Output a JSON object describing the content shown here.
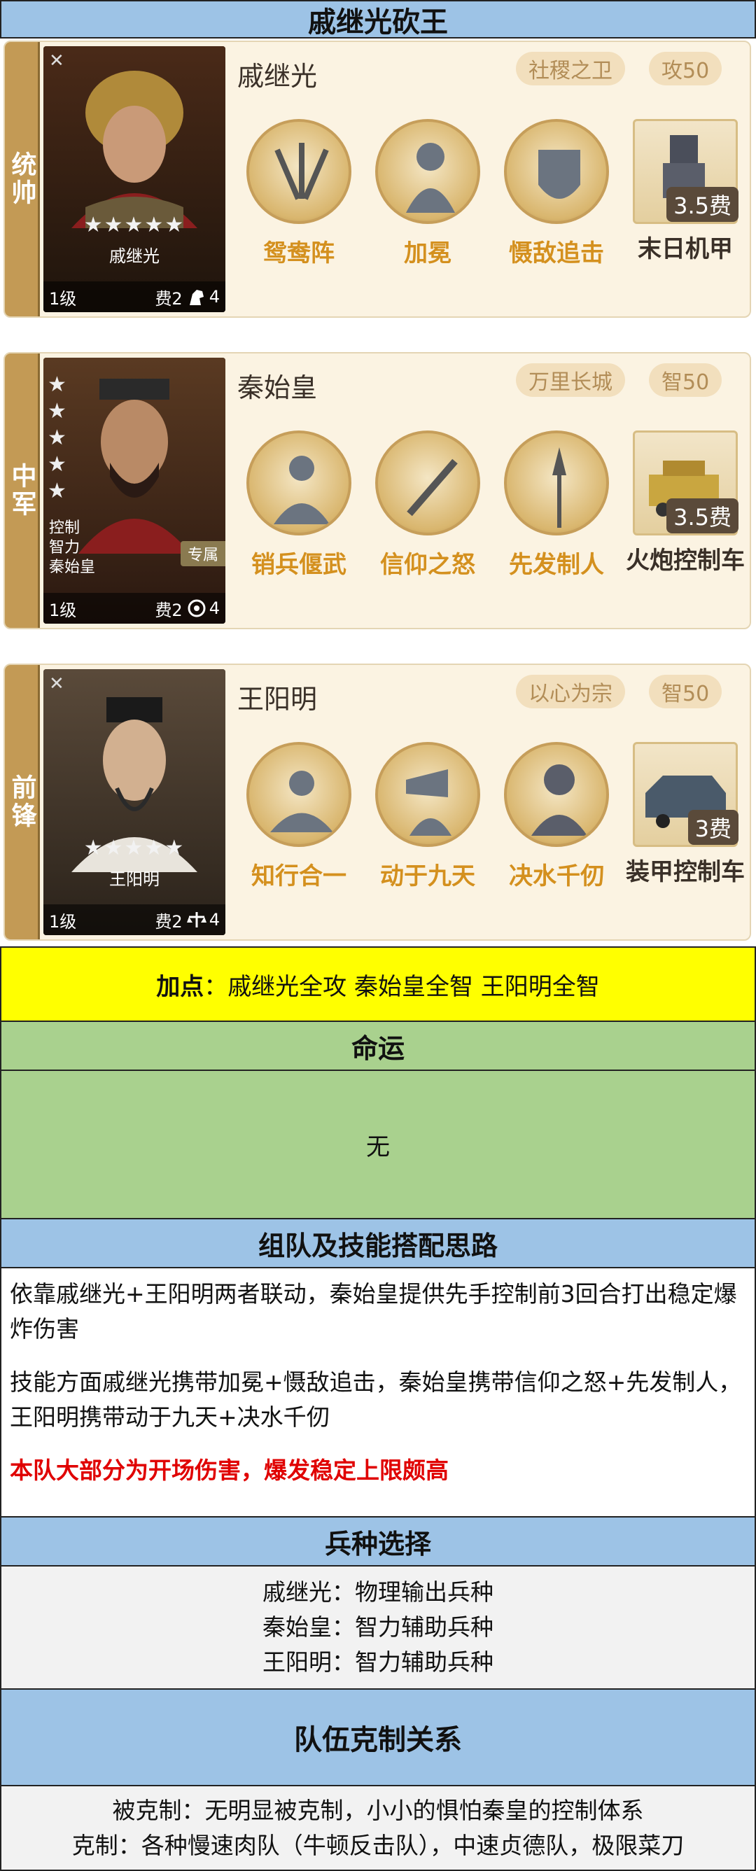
{
  "title": "戚继光砍王",
  "generals": [
    {
      "role": "统帅",
      "name": "戚继光",
      "portrait_name": "戚继光",
      "stars": "★★★★★",
      "level": "1级",
      "cost": "费2",
      "unit_count": "4",
      "tags": [
        "社稷之卫",
        "攻50"
      ],
      "skills": [
        "鸳鸯阵",
        "加冕",
        "慑敌追击"
      ],
      "gear": {
        "label": "末日机甲",
        "cost": "3.5费"
      }
    },
    {
      "role": "中军",
      "name": "秦始皇",
      "portrait_name": "秦始皇",
      "portrait_traits": [
        "控制",
        "智力"
      ],
      "portrait_badge": "专属",
      "stars": "★★★★★",
      "level": "1级",
      "cost": "费2",
      "unit_count": "4",
      "tags": [
        "万里长城",
        "智50"
      ],
      "skills": [
        "销兵偃武",
        "信仰之怒",
        "先发制人"
      ],
      "gear": {
        "label": "火炮控制车",
        "cost": "3.5费"
      }
    },
    {
      "role": "前锋",
      "name": "王阳明",
      "portrait_name": "王阳明",
      "stars": "★★★★★",
      "level": "1级",
      "cost": "费2",
      "unit_count": "4",
      "tags": [
        "以心为宗",
        "智50"
      ],
      "skills": [
        "知行合一",
        "动于九天",
        "决水千仞"
      ],
      "gear": {
        "label": "装甲控制车",
        "cost": "3费"
      }
    }
  ],
  "plus": {
    "label": "加点",
    "sep": "：",
    "value": "戚继光全攻 秦始皇全智 王阳明全智"
  },
  "fate": {
    "heading": "命运",
    "value": "无"
  },
  "strategy": {
    "heading": "组队及技能搭配思路",
    "p1": "依靠戚继光+王阳明两者联动，秦始皇提供先手控制前3回合打出稳定爆炸伤害",
    "p2": "技能方面戚继光携带加冕+慑敌追击，秦始皇携带信仰之怒+先发制人，王阳明携带动于九天+决水千仞",
    "p3": "本队大部分为开场伤害，爆发稳定上限颇高"
  },
  "troops": {
    "heading": "兵种选择",
    "lines": [
      "戚继光：物理输出兵种",
      "秦始皇：智力辅助兵种",
      "王阳明：智力辅助兵种"
    ]
  },
  "relation": {
    "heading": "队伍克制关系",
    "lines": [
      "被克制：无明显被克制，小小的惧怕秦皇的控制体系",
      "克制：各种慢速肉队（牛顿反击队），中速贞德队，极限菜刀"
    ]
  },
  "colors": {
    "blue_header": "#9dc3e6",
    "green": "#a9d18e",
    "yellow": "#ffff00",
    "red_text": "#e00000",
    "skill_label": "#d4901e"
  }
}
